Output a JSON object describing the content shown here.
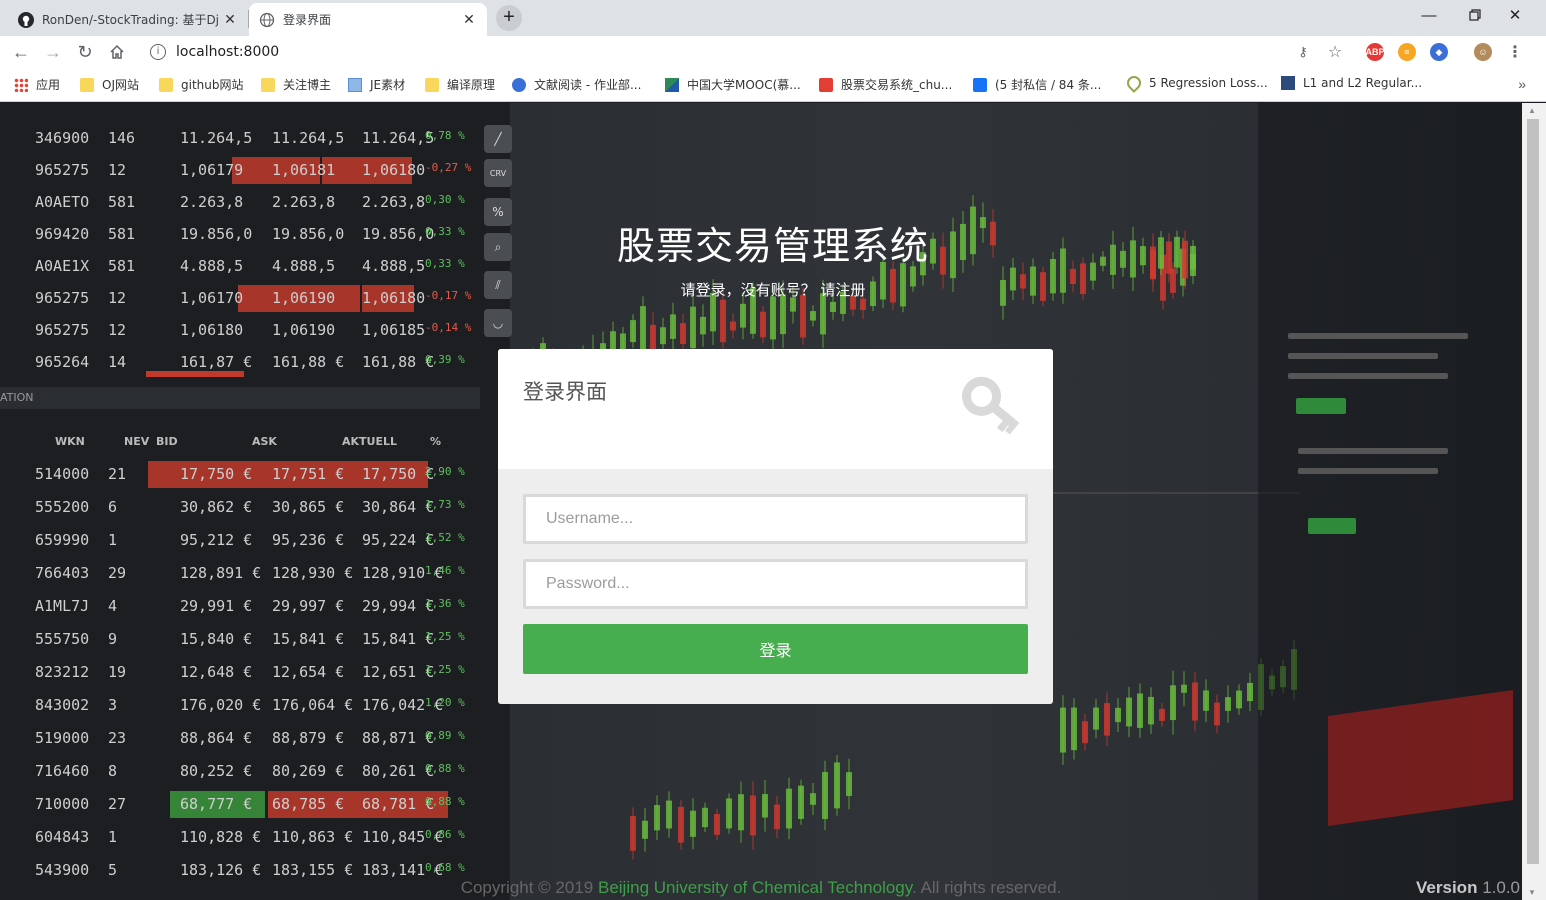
{
  "browser": {
    "tabs": [
      {
        "title": "RonDen/-StockTrading: 基于Dj",
        "active": false
      },
      {
        "title": "登录界面",
        "active": true
      }
    ],
    "url": "localhost:8000",
    "bookmarks": [
      {
        "label": "应用",
        "icon": "apps-icon"
      },
      {
        "label": "OJ网站",
        "icon": "folder-icon"
      },
      {
        "label": "github网站",
        "icon": "folder-icon"
      },
      {
        "label": "关注博主",
        "icon": "folder-icon"
      },
      {
        "label": "JE素材",
        "icon": "image-icon"
      },
      {
        "label": "编译原理",
        "icon": "folder-icon"
      },
      {
        "label": "文献阅读 - 作业部...",
        "icon": "edge-icon"
      },
      {
        "label": "中国大学MOOC(慕...",
        "icon": "mooc-icon"
      },
      {
        "label": "股票交易系统_chu...",
        "icon": "csdn-icon"
      },
      {
        "label": "(5 封私信 / 84 条...",
        "icon": "zhihu-icon"
      },
      {
        "label": "5 Regression Loss...",
        "icon": "heart-icon"
      },
      {
        "label": "L1 and L2 Regular...",
        "icon": "doc-icon"
      }
    ]
  },
  "hero": {
    "title": "股票交易管理系统",
    "subtitle": "请登录，没有账号？",
    "register_link": "请注册"
  },
  "login": {
    "card_title": "登录界面",
    "username_placeholder": "Username...",
    "password_placeholder": "Password...",
    "submit_label": "登录"
  },
  "footer": {
    "copyright_prefix": "Copyright © 2019",
    "organization": "Beijing University of Chemical Technology",
    "rights": ". All rights reserved.",
    "version_label": "Version",
    "version_number": "1.0.0"
  },
  "background_quotes": {
    "rows": [
      [
        "346900",
        "146",
        "11.264,5",
        "11.264,5",
        "11.264,5",
        "0,78 %"
      ],
      [
        "965275",
        "12",
        "1,06179",
        "1,06181",
        "1,06180",
        "-0,27 %"
      ],
      [
        "A0AETO",
        "581",
        "2.263,8",
        "2.263,8",
        "2.263,8",
        "0,30 %"
      ],
      [
        "969420",
        "581",
        "19.856,0",
        "19.856,0",
        "19.856,0",
        "0,33 %"
      ],
      [
        "A0AE1X",
        "581",
        "4.888,5",
        "4.888,5",
        "4.888,5",
        "0,33 %"
      ],
      [
        "965275",
        "12",
        "1,06170",
        "1,06190",
        "1,06180",
        "-0,17 %"
      ],
      [
        "965275",
        "12",
        "1,06180",
        "1,06190",
        "1,06185",
        "-0,14 %"
      ],
      [
        "965264",
        "14",
        "161,87 €",
        "161,88 €",
        "161,88 €",
        "0,39 %"
      ]
    ],
    "headers": [
      "WKN",
      "NEV",
      "BID",
      "ASK",
      "AKTUELL",
      "%"
    ],
    "rows2": [
      [
        "514000",
        "21",
        "17,750 €",
        "17,751 €",
        "17,750 €",
        "2,90 %"
      ],
      [
        "555200",
        "6",
        "30,862 €",
        "30,865 €",
        "30,864 €",
        "1,73 %"
      ],
      [
        "659990",
        "1",
        "95,212 €",
        "95,236 €",
        "95,224 €",
        "1,52 %"
      ],
      [
        "766403",
        "29",
        "128,891 €",
        "128,930 €",
        "128,910 €",
        "1,46 %"
      ],
      [
        "A1ML7J",
        "4",
        "29,991 €",
        "29,997 €",
        "29,994 €",
        "1,36 %"
      ],
      [
        "555750",
        "9",
        "15,840 €",
        "15,841 €",
        "15,841 €",
        "1,25 %"
      ],
      [
        "823212",
        "19",
        "12,648 €",
        "12,654 €",
        "12,651 €",
        "1,25 %"
      ],
      [
        "843002",
        "3",
        "176,020 €",
        "176,064 €",
        "176,042 €",
        "1,20 %"
      ],
      [
        "519000",
        "23",
        "88,864 €",
        "88,879 €",
        "88,871 €",
        "0,89 %"
      ],
      [
        "716460",
        "8",
        "80,252 €",
        "80,269 €",
        "80,261 €",
        "0,88 %"
      ],
      [
        "710000",
        "27",
        "68,777 €",
        "68,785 €",
        "68,781 €",
        "0,88 %"
      ],
      [
        "604843",
        "1",
        "110,828 €",
        "110,863 €",
        "110,845 €",
        "0,86 %"
      ],
      [
        "543900",
        "5",
        "183,126 €",
        "183,155 €",
        "183,141 €",
        "0,68 %"
      ]
    ]
  },
  "colors": {
    "accent_green": "#47ae4f",
    "link_green": "#3e9f48",
    "card_bg": "#eeeeee"
  }
}
